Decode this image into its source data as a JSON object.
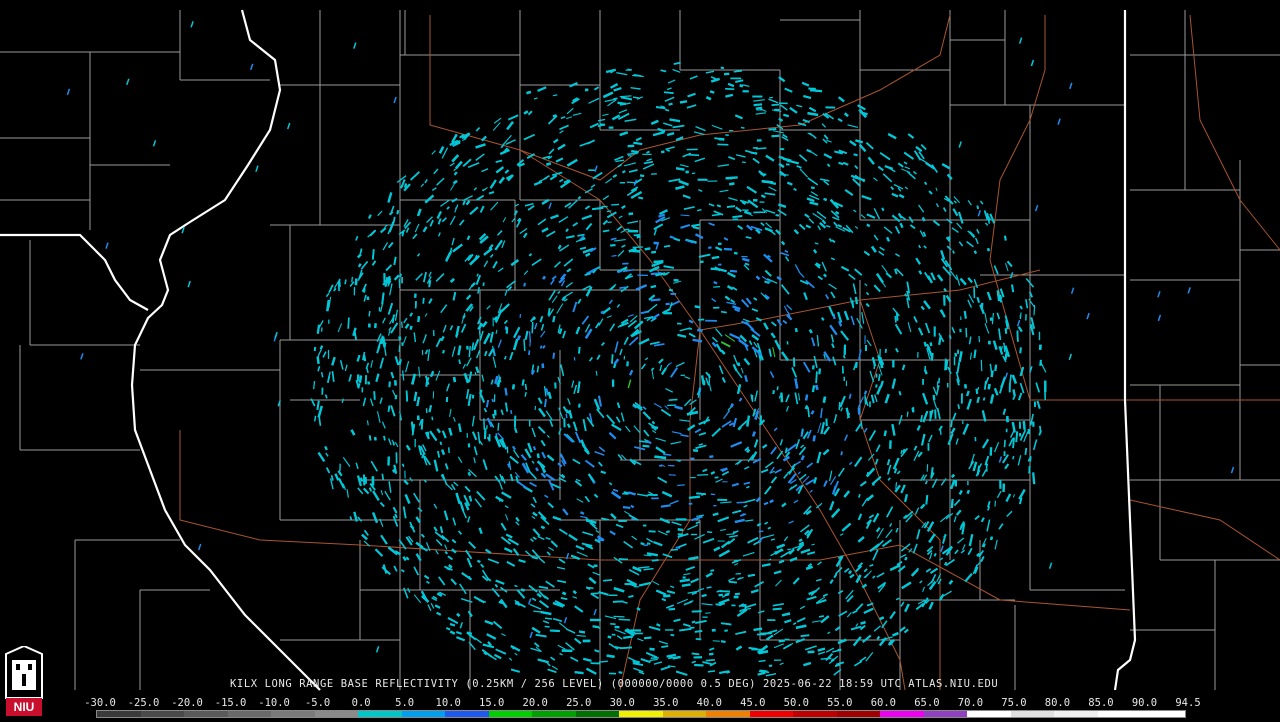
{
  "caption": {
    "text": "KILX LONG RANGE BASE REFLECTIVITY (0.25KM / 256 LEVEL) (000000/0000 0.5 DEG) 2025-06-22 18:59 UTC  ATLAS.NIU.EDU"
  },
  "logo": {
    "text": "NIU",
    "bg_color": "#c8102e"
  },
  "legend": {
    "tick_labels": [
      "-30.0",
      "-25.0",
      "-20.0",
      "-15.0",
      "-10.0",
      "-5.0",
      "0.0",
      "5.0",
      "10.0",
      "15.0",
      "20.0",
      "25.0",
      "30.0",
      "35.0",
      "40.0",
      "45.0",
      "50.0",
      "55.0",
      "60.0",
      "65.0",
      "70.0",
      "75.0",
      "80.0",
      "85.0",
      "90.0",
      "94.5"
    ],
    "colors": [
      "#3a3a3a",
      "#4a4a4a",
      "#5a5a5a",
      "#6a6a6a",
      "#7a7a7a",
      "#8a8a8a",
      "#00c8c8",
      "#00a0f0",
      "#1e5af0",
      "#00d000",
      "#00a000",
      "#007000",
      "#f0f000",
      "#e0b000",
      "#f08000",
      "#f00000",
      "#c00000",
      "#a00000",
      "#f000f0",
      "#9040c0",
      "#ffffff",
      "#e0e0e0",
      "#f0f0f0",
      "#ffffff",
      "#ffffff"
    ]
  },
  "colors": {
    "echo_main": "#00c8d8",
    "echo_blue": "#1e8cf0",
    "echo_green": "#30c030",
    "state_border": "#ffffff",
    "county_border": "#a0a0a0",
    "highway": "#b05a30"
  }
}
